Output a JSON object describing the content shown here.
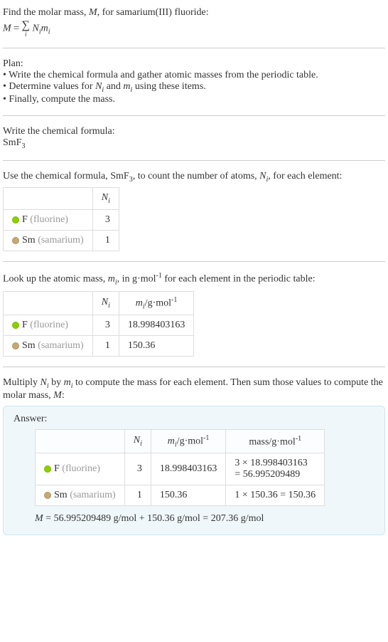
{
  "title": {
    "prefix": "Find the molar mass, ",
    "var": "M",
    "suffix": ", for samarium(III) fluoride:"
  },
  "formula_main": {
    "lhs": "M",
    "eq": " = ",
    "sigma": "∑",
    "sub": "i",
    "rhs_n": "N",
    "rhs_n_sub": "i",
    "rhs_m": "m",
    "rhs_m_sub": "i"
  },
  "plan": {
    "heading": "Plan:",
    "items": [
      "• Write the chemical formula and gather atomic masses from the periodic table.",
      "• Determine values for Nᵢ and mᵢ using these items.",
      "• Finally, compute the mass."
    ]
  },
  "step1": {
    "heading": "Write the chemical formula:",
    "formula_base": "SmF",
    "formula_sub": "3"
  },
  "step2": {
    "prefix": "Use the chemical formula, SmF",
    "sub1": "3",
    "mid": ", to count the number of atoms, ",
    "var": "N",
    "varsub": "i",
    "suffix": ", for each element:"
  },
  "table1": {
    "header_n": "N",
    "header_n_sub": "i",
    "rows": [
      {
        "dot": "green",
        "sym": "F",
        "name": " (fluorine)",
        "n": "3"
      },
      {
        "dot": "tan",
        "sym": "Sm",
        "name": " (samarium)",
        "n": "1"
      }
    ]
  },
  "step3": {
    "prefix": "Look up the atomic mass, ",
    "var": "m",
    "varsub": "i",
    "mid": ", in g·mol",
    "sup": "-1",
    "suffix": " for each element in the periodic table:"
  },
  "table2": {
    "header_n": "N",
    "header_n_sub": "i",
    "header_m": "m",
    "header_m_sub": "i",
    "header_m_unit": "/g·mol",
    "header_m_sup": "-1",
    "rows": [
      {
        "dot": "green",
        "sym": "F",
        "name": " (fluorine)",
        "n": "3",
        "m": "18.998403163"
      },
      {
        "dot": "tan",
        "sym": "Sm",
        "name": " (samarium)",
        "n": "1",
        "m": "150.36"
      }
    ]
  },
  "step4": {
    "prefix": "Multiply ",
    "n": "N",
    "nsub": "i",
    "by": " by ",
    "m": "m",
    "msub": "i",
    "mid": " to compute the mass for each element. Then sum those values to compute the molar mass, ",
    "mvar": "M",
    "suffix": ":"
  },
  "answer": {
    "label": "Answer:",
    "table": {
      "header_n": "N",
      "header_n_sub": "i",
      "header_m": "m",
      "header_m_sub": "i",
      "header_m_unit": "/g·mol",
      "header_m_sup": "-1",
      "header_mass": "mass/g·mol",
      "header_mass_sup": "-1",
      "rows": [
        {
          "dot": "green",
          "sym": "F",
          "name": " (fluorine)",
          "n": "3",
          "m": "18.998403163",
          "mass_line1": "3 × 18.998403163",
          "mass_line2": "= 56.995209489"
        },
        {
          "dot": "tan",
          "sym": "Sm",
          "name": " (samarium)",
          "n": "1",
          "m": "150.36",
          "mass_line1": "1 × 150.36 = 150.36",
          "mass_line2": ""
        }
      ]
    },
    "result": {
      "var": "M",
      "text": " = 56.995209489 g/mol + 150.36 g/mol = 207.36 g/mol"
    }
  }
}
